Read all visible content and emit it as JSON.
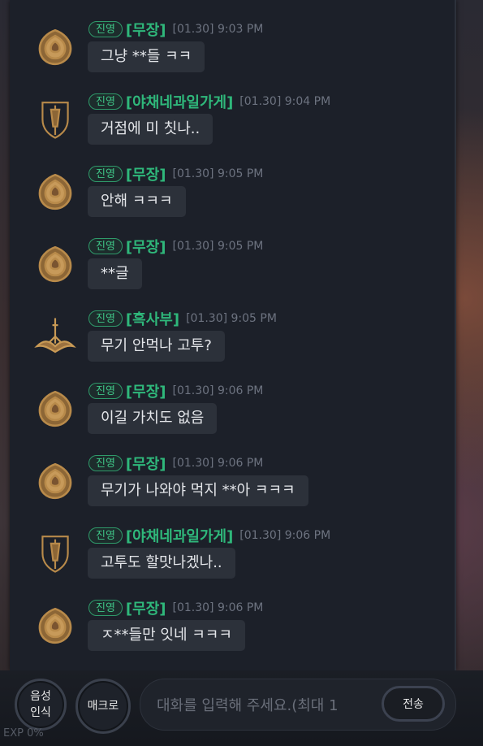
{
  "messages": [
    {
      "badge": "진영",
      "name": "[무장]",
      "time": "[01.30] 9:03 PM",
      "text": "그냥 **들 ㅋㅋ",
      "avatar": "rose-emblem-icon"
    },
    {
      "badge": "진영",
      "name": "[야채네과일가게]",
      "time": "[01.30] 9:04 PM",
      "text": "거점에 미 칫나..",
      "avatar": "shield-sword-emblem-icon"
    },
    {
      "badge": "진영",
      "name": "[무장]",
      "time": "[01.30] 9:05 PM",
      "text": "안해 ㅋㅋㅋ",
      "avatar": "rose-emblem-icon"
    },
    {
      "badge": "진영",
      "name": "[무장]",
      "time": "[01.30] 9:05 PM",
      "text": "**글",
      "avatar": "rose-emblem-icon"
    },
    {
      "badge": "진영",
      "name": "[흑사부]",
      "time": "[01.30] 9:05 PM",
      "text": "무기 안먹나 고투?",
      "avatar": "winged-sword-emblem-icon"
    },
    {
      "badge": "진영",
      "name": "[무장]",
      "time": "[01.30] 9:06 PM",
      "text": "이길 가치도 없음",
      "avatar": "rose-emblem-icon"
    },
    {
      "badge": "진영",
      "name": "[무장]",
      "time": "[01.30] 9:06 PM",
      "text": "무기가 나와야 먹지 **아 ㅋㅋㅋ",
      "avatar": "rose-emblem-icon"
    },
    {
      "badge": "진영",
      "name": "[야채네과일가게]",
      "time": "[01.30] 9:06 PM",
      "text": "고투도 할맛나겠나..",
      "avatar": "shield-sword-emblem-icon"
    },
    {
      "badge": "진영",
      "name": "[무장]",
      "time": "[01.30] 9:06 PM",
      "text": "ㅈ**들만 잇네 ㅋㅋㅋ",
      "avatar": "rose-emblem-icon"
    }
  ],
  "input_bar": {
    "voice_label_1": "음성",
    "voice_label_2": "인식",
    "macro_label": "매크로",
    "placeholder": "대화를 입력해 주세요.(최대 1",
    "send_label": "전송"
  },
  "hud": {
    "exp": "EXP 0%"
  },
  "colors": {
    "badge": "#3fc486",
    "name": "#2fb87b",
    "time": "#6d7380",
    "bubble": "#2c313a",
    "emblem_gold": "#b88a4a"
  }
}
